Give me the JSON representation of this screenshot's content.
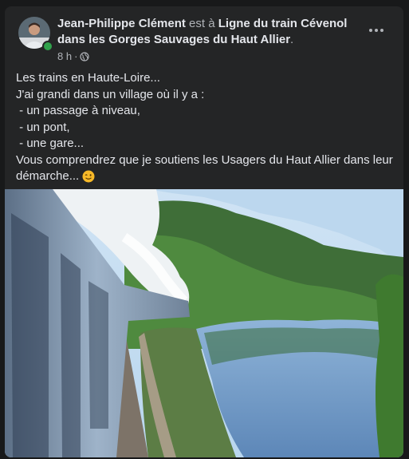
{
  "post": {
    "author": "Jean-Philippe Clément",
    "connector": "est à",
    "place": "Ligne du train Cévenol dans les Gorges Sauvages du Haut Allier",
    "period": ".",
    "timestamp": "8 h",
    "audience_icon": "globe-icon",
    "lines": [
      "Les trains en Haute-Loire...",
      "J'ai grandi dans un village où il y a :",
      " - un passage à niveau,",
      " - un pont,",
      " - une gare...",
      "Vous comprendrez que je soutiens les Usagers du Haut Allier dans leur",
      "démarche... "
    ],
    "emoji": "wink-emoji",
    "photo": "train-gorge-photo"
  },
  "colors": {
    "card_bg": "#242526",
    "text": "#e4e6eb",
    "secondary_text": "#b0b3b8",
    "online": "#31a24c"
  }
}
